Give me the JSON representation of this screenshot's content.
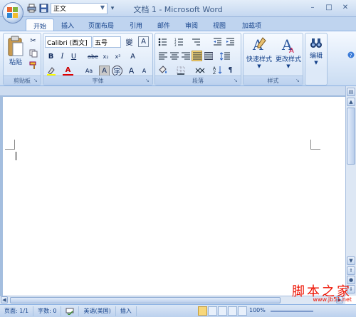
{
  "titlebar": {
    "title": "文档 1 - Microsoft Word",
    "style_selector_value": "正文",
    "qat_more": "▾",
    "window_controls": {
      "minimize": "–",
      "maximize": "□",
      "close": "✕"
    }
  },
  "tabs": [
    {
      "label": "开始"
    },
    {
      "label": "插入"
    },
    {
      "label": "页面布局"
    },
    {
      "label": "引用"
    },
    {
      "label": "邮件"
    },
    {
      "label": "审阅"
    },
    {
      "label": "视图"
    },
    {
      "label": "加载项"
    }
  ],
  "ribbon": {
    "clipboard": {
      "label": "剪贴板",
      "paste": "粘贴"
    },
    "font": {
      "label": "字体",
      "font_name": "Calibri (西文]",
      "font_size": "五号",
      "bold": "B",
      "italic": "I",
      "underline": "U",
      "strike": "abe",
      "subscript": "x₂",
      "superscript": "x²",
      "clear_format": "A",
      "font_color": "A",
      "change_case": "Aa",
      "char_border": "A",
      "grow": "A",
      "shrink": "A"
    },
    "paragraph": {
      "label": "段落"
    },
    "styles": {
      "label": "样式",
      "quick_styles": "快速样式",
      "change_styles": "更改样式"
    },
    "editing": {
      "label": "编辑"
    }
  },
  "statusbar": {
    "page": "页面: 1/1",
    "words": "字数: 0",
    "language": "英语(美国)",
    "mode": "插入",
    "zoom": "100%"
  },
  "watermark": {
    "text": "脚本之家",
    "url": "www.jb51.net"
  }
}
